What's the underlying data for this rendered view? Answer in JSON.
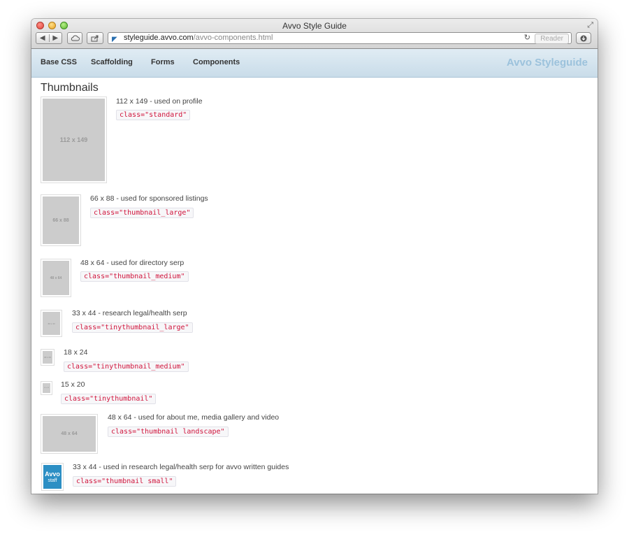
{
  "window": {
    "title": "Avvo Style Guide"
  },
  "toolbar": {
    "back_icon": "back-arrow-icon",
    "forward_icon": "forward-arrow-icon",
    "url_host": "styleguide.avvo.com",
    "url_path": "/avvo-components.html",
    "reader_label": "Reader"
  },
  "nav": {
    "items": [
      {
        "label": "Base CSS"
      },
      {
        "label": "Scaffolding"
      },
      {
        "label": "Forms"
      },
      {
        "label": "Components"
      }
    ],
    "brand": "Avvo Styleguide"
  },
  "page": {
    "heading": "Thumbnails",
    "thumbnails": [
      {
        "placeholder": "112 x 149",
        "desc": "112 x 149 - used on profile",
        "class_code": "class=\"standard\""
      },
      {
        "placeholder": "66 x 88",
        "desc": "66 x 88 - used for sponsored listings",
        "class_code": "class=\"thumbnail_large\""
      },
      {
        "placeholder": "48 x 64",
        "desc": "48 x 64 - used for directory serp",
        "class_code": "class=\"thumbnail_medium\""
      },
      {
        "placeholder": "33 x 44",
        "desc": "33 x 44 - research legal/health serp",
        "class_code": "class=\"tinythumbnail_large\""
      },
      {
        "placeholder": "18 x 24",
        "desc": "18 x 24",
        "class_code": "class=\"tinythumbnail_medium\""
      },
      {
        "placeholder": "15 x 20",
        "desc": "15 x 20",
        "class_code": "class=\"tinythumbnail\""
      },
      {
        "placeholder": "48 x 64",
        "desc": "48 x 64 - used for about me, media gallery and video",
        "class_code": "class=\"thumbnail landscape\""
      },
      {
        "placeholder_top": "Avvo",
        "placeholder_bottom": "staff",
        "desc": "33 x 44 - used in research legal/health serp for avvo written guides",
        "class_code": "class=\"thumbnail small\""
      }
    ]
  },
  "colors": {
    "navbar_bg": "#c9dce9",
    "brand": "#9cc2dc",
    "code_text": "#d0143c",
    "thumb_placeholder": "#cccccc",
    "avvo_blue": "#2c8fc4"
  }
}
